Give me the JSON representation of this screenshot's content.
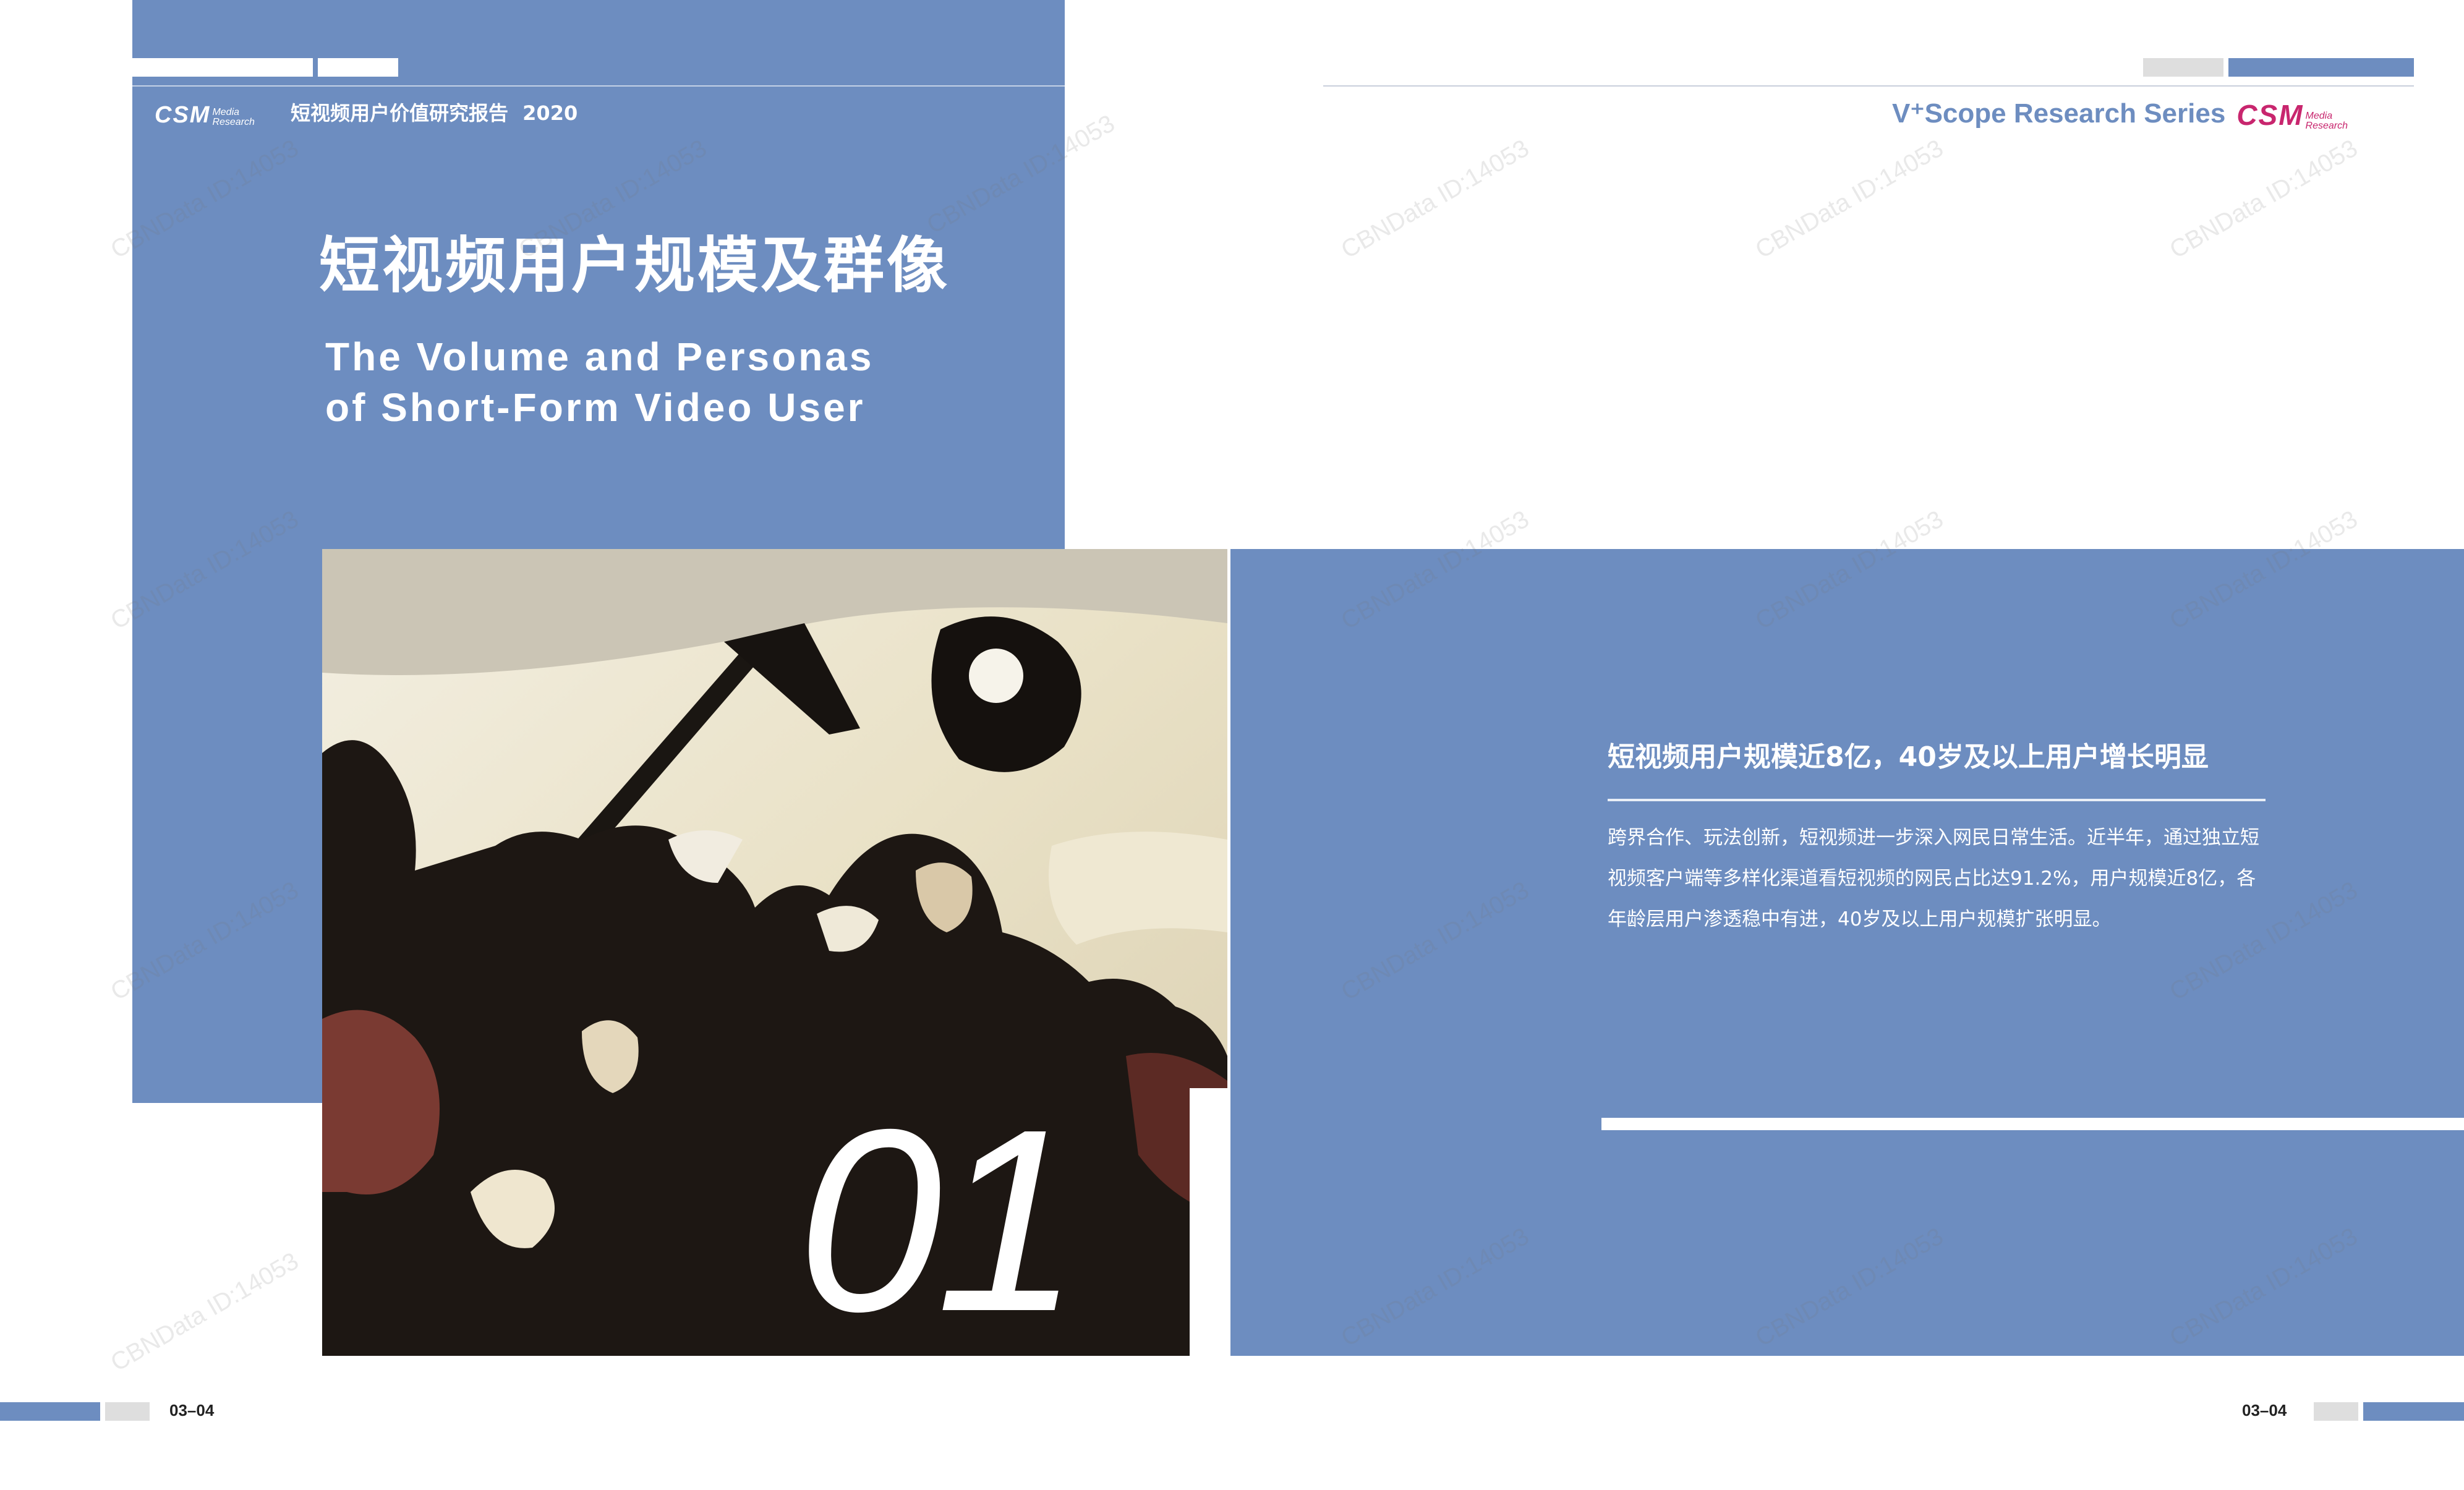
{
  "header": {
    "brand": "CSM",
    "brand_sub_1": "Media",
    "brand_sub_2": "Research",
    "report_title": "短视频用户价值研究报告",
    "report_year": "2020",
    "series": "V⁺Scope Research Series"
  },
  "chapter": {
    "title_cn": "短视频用户规模及群像",
    "title_en_line1": "The Volume and Personas",
    "title_en_line2": "of Short-Form Video User",
    "number": "01"
  },
  "section": {
    "heading": "短视频用户规模近8亿，40岁及以上用户增长明显",
    "body": "跨界合作、玩法创新，短视频进一步深入网民日常生活。近半年，通过独立短视频客户端等多样化渠道看短视频的网民占比达91.2%，用户规模近8亿，各年龄层用户渗透稳中有进，40岁及以上用户规模扩张明显。"
  },
  "footer": {
    "page_left": "03–04",
    "page_right": "03–04"
  },
  "watermark": "CBNData ID:14053",
  "colors": {
    "accent_blue": "#6d8dc0",
    "brand_magenta": "#c8266e",
    "light_grey": "#dedede"
  }
}
